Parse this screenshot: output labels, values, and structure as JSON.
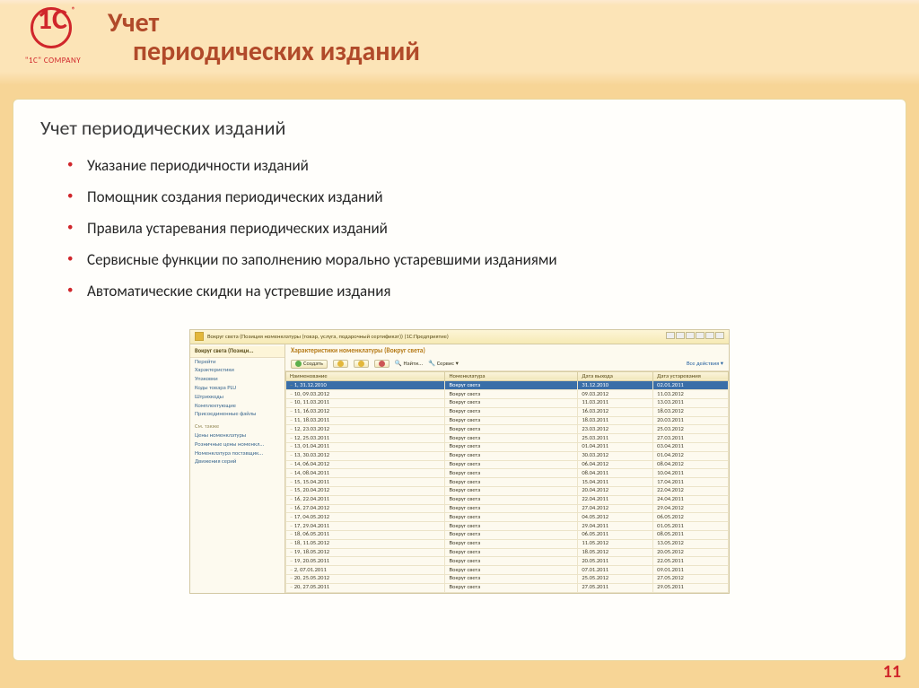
{
  "logo_tag": "\"1C\" COMPANY",
  "title_l1": "Учет",
  "title_l2": "периодических изданий",
  "section_heading": "Учет периодических изданий",
  "bullets": [
    "Указание периодичности изданий",
    "Помощник создания периодических изданий",
    "Правила устаревания периодических изданий",
    "Сервисные функции по заполнению морально устаревшими изданиями",
    "Автоматические скидки на устревшие издания"
  ],
  "embed": {
    "window_title": "Вокруг света (Позиция номенклатуры (товар, услуга, подарочный сертификат))  (1С:Предприятие)",
    "sidebar_head": "Вокруг света (Позици...",
    "sidebar_items": [
      "Перейти",
      "Характеристики",
      "Упаковки",
      "Коды товара PLU",
      "Штрихкоды",
      "Комплектующие",
      "Присоединенные файлы"
    ],
    "sidebar_see_also": "См. также",
    "sidebar_items2": [
      "Цены номенклатуры",
      "Розничные цены номенкл...",
      "Номенклатура поставщик...",
      "Движения серий"
    ],
    "main_title": "Характеристики номенклатуры (Вокруг света)",
    "toolbar": {
      "create": "Создать",
      "find": "Найти...",
      "service": "Сервис",
      "all_actions": "Все действия"
    },
    "columns": [
      "Наименование",
      "Номенклатура",
      "Дата выхода",
      "Дата устаревания"
    ],
    "nomenclature_value": "Вокруг света",
    "rows": [
      {
        "name": "1, 31.12.2010",
        "d1": "31.12.2010",
        "d2": "02.01.2011",
        "sel": true
      },
      {
        "name": "10, 09.03.2012",
        "d1": "09.03.2012",
        "d2": "11.03.2012"
      },
      {
        "name": "10, 11.03.2011",
        "d1": "11.03.2011",
        "d2": "13.03.2011"
      },
      {
        "name": "11, 16.03.2012",
        "d1": "16.03.2012",
        "d2": "18.03.2012"
      },
      {
        "name": "11, 18.03.2011",
        "d1": "18.03.2011",
        "d2": "20.03.2011"
      },
      {
        "name": "12, 23.03.2012",
        "d1": "23.03.2012",
        "d2": "25.03.2012"
      },
      {
        "name": "12, 25.03.2011",
        "d1": "25.03.2011",
        "d2": "27.03.2011"
      },
      {
        "name": "13, 01.04.2011",
        "d1": "01.04.2011",
        "d2": "03.04.2011"
      },
      {
        "name": "13, 30.03.2012",
        "d1": "30.03.2012",
        "d2": "01.04.2012"
      },
      {
        "name": "14, 06.04.2012",
        "d1": "06.04.2012",
        "d2": "08.04.2012"
      },
      {
        "name": "14, 08.04.2011",
        "d1": "08.04.2011",
        "d2": "10.04.2011"
      },
      {
        "name": "15, 15.04.2011",
        "d1": "15.04.2011",
        "d2": "17.04.2011"
      },
      {
        "name": "15, 20.04.2012",
        "d1": "20.04.2012",
        "d2": "22.04.2012"
      },
      {
        "name": "16, 22.04.2011",
        "d1": "22.04.2011",
        "d2": "24.04.2011"
      },
      {
        "name": "16, 27.04.2012",
        "d1": "27.04.2012",
        "d2": "29.04.2012"
      },
      {
        "name": "17, 04.05.2012",
        "d1": "04.05.2012",
        "d2": "06.05.2012"
      },
      {
        "name": "17, 29.04.2011",
        "d1": "29.04.2011",
        "d2": "01.05.2011"
      },
      {
        "name": "18, 06.05.2011",
        "d1": "06.05.2011",
        "d2": "08.05.2011"
      },
      {
        "name": "18, 11.05.2012",
        "d1": "11.05.2012",
        "d2": "13.05.2012"
      },
      {
        "name": "19, 18.05.2012",
        "d1": "18.05.2012",
        "d2": "20.05.2012"
      },
      {
        "name": "19, 20.05.2011",
        "d1": "20.05.2011",
        "d2": "22.05.2011"
      },
      {
        "name": "2, 07.01.2011",
        "d1": "07.01.2011",
        "d2": "09.01.2011"
      },
      {
        "name": "20, 25.05.2012",
        "d1": "25.05.2012",
        "d2": "27.05.2012"
      },
      {
        "name": "20, 27.05.2011",
        "d1": "27.05.2011",
        "d2": "29.05.2011"
      }
    ]
  },
  "page_number": "11"
}
